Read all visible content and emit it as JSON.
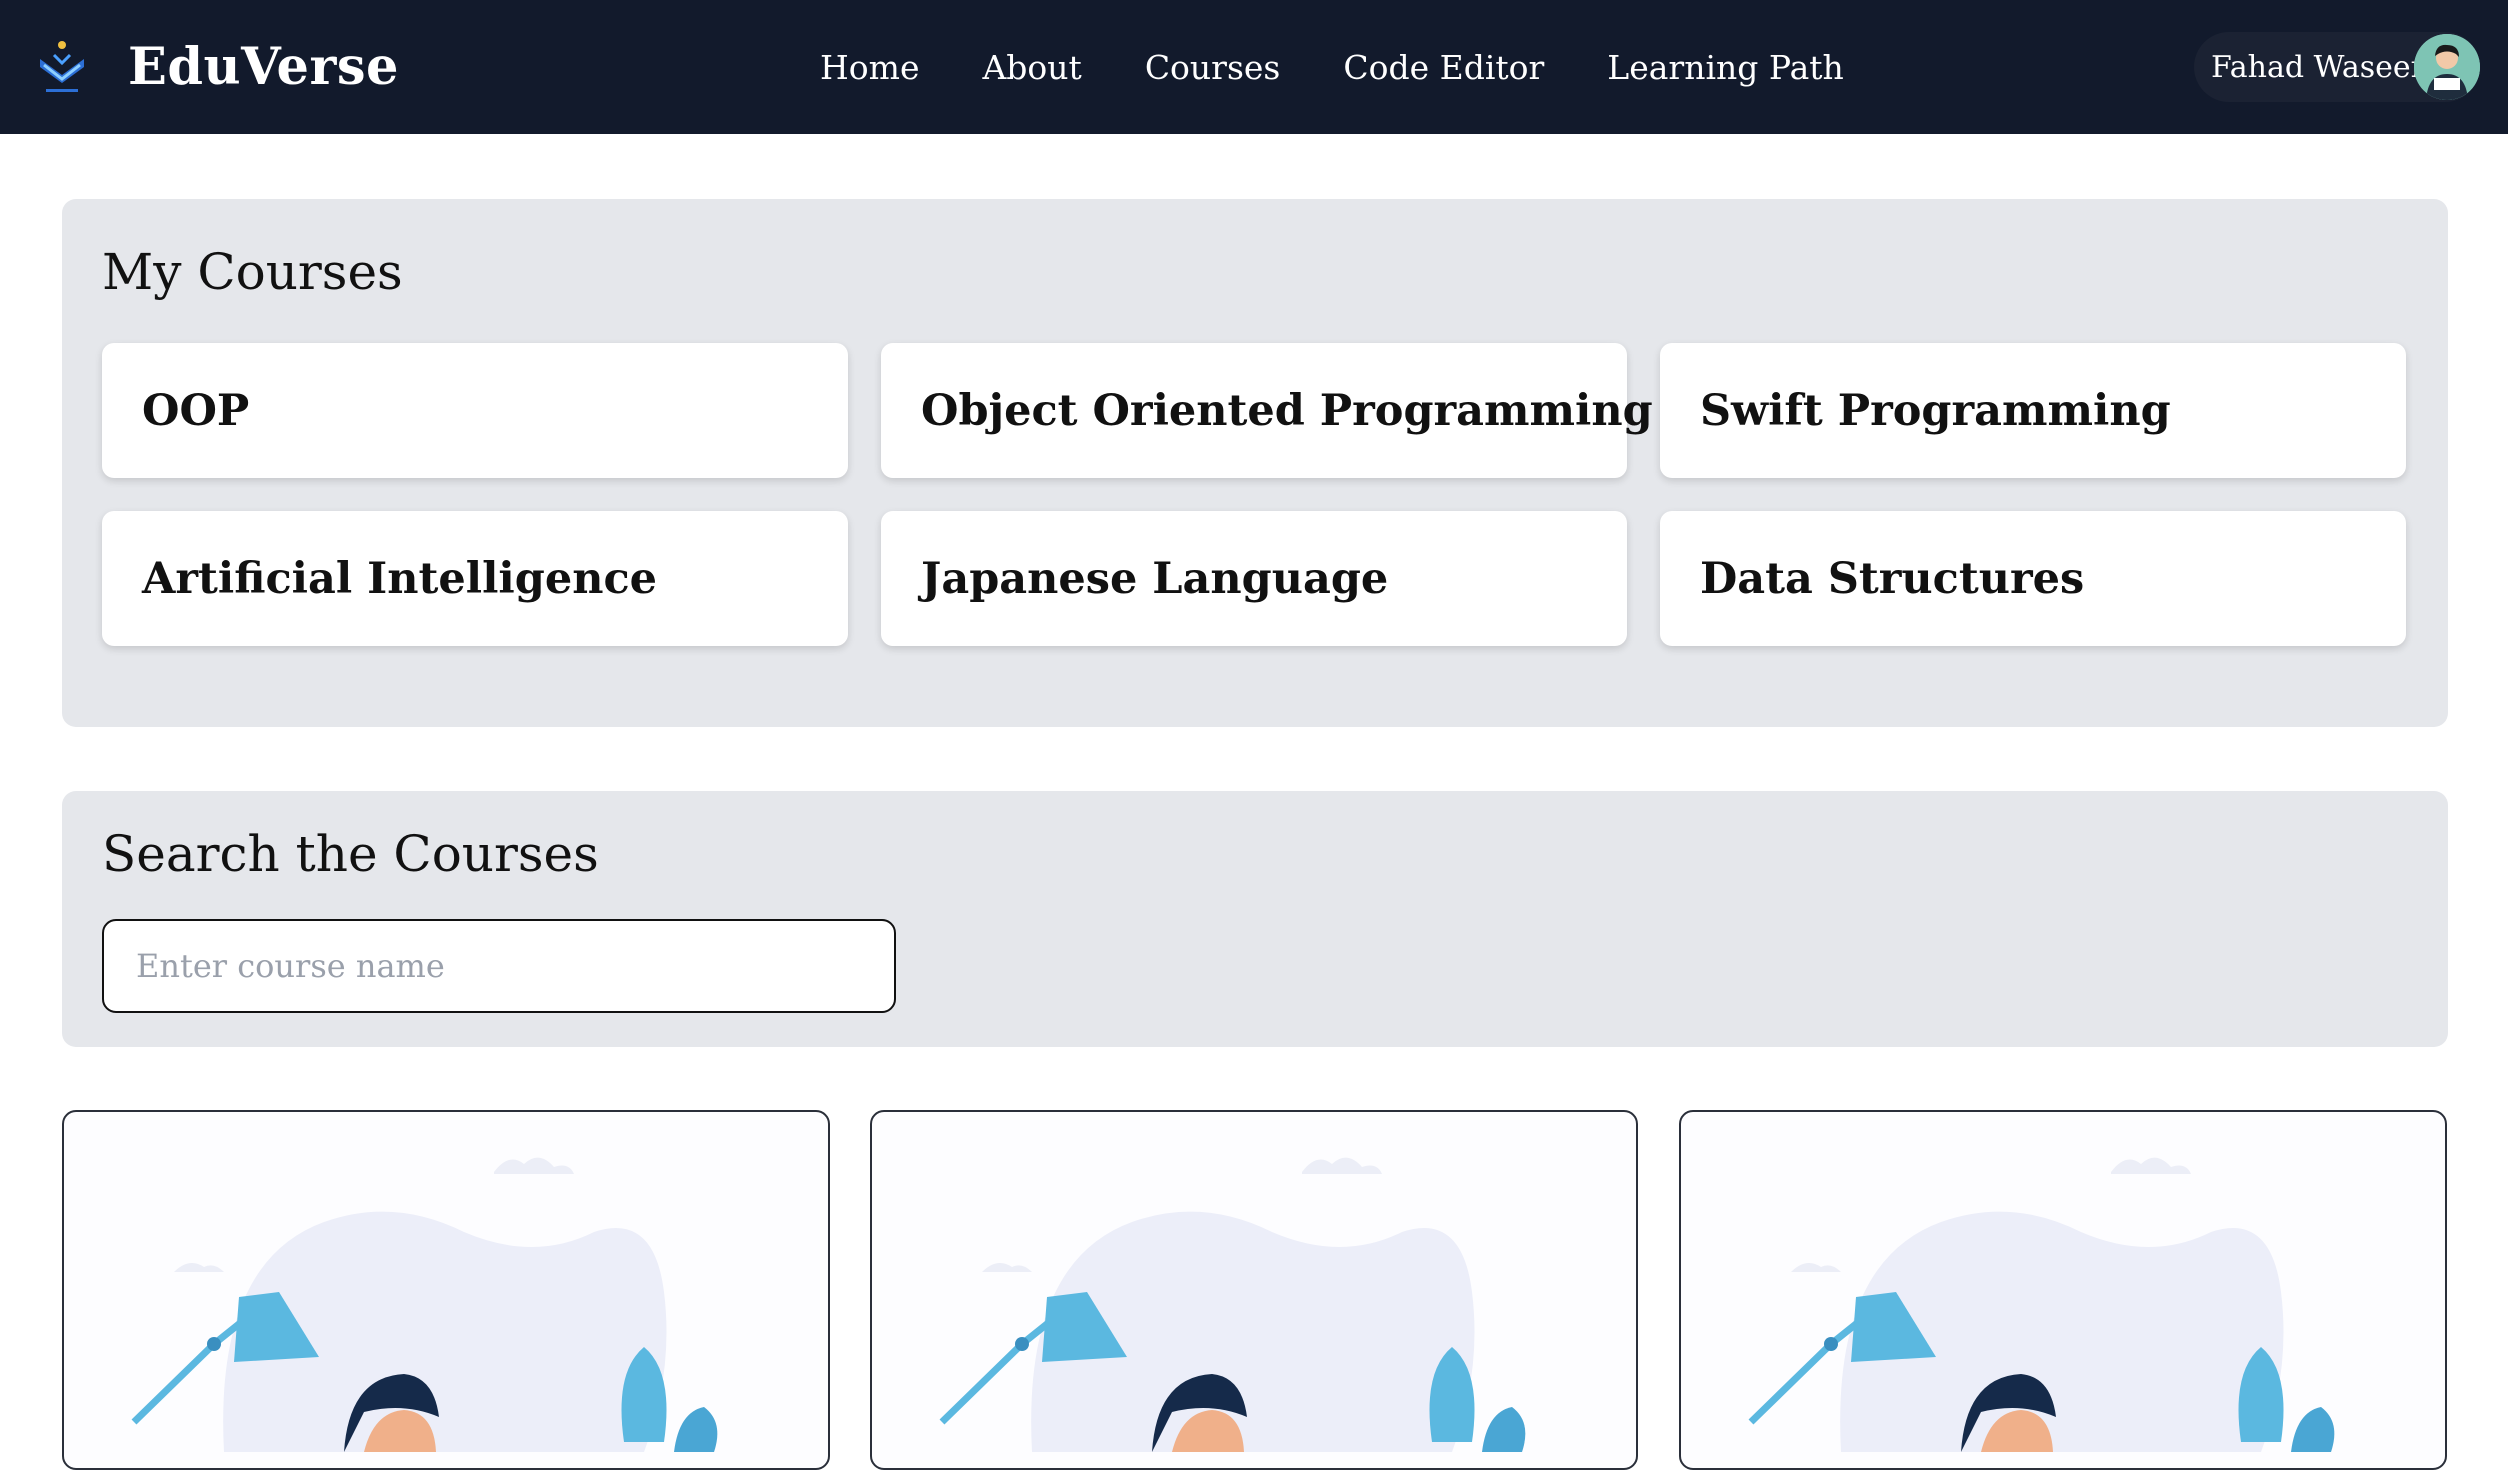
{
  "navbar": {
    "brand_name": "EduVerse",
    "logo_icon": "eduverse-logo-icon",
    "links": [
      {
        "label": "Home"
      },
      {
        "label": "About"
      },
      {
        "label": "Courses"
      },
      {
        "label": "Code Editor"
      },
      {
        "label": "Learning Path"
      }
    ],
    "user": {
      "name": "Fahad Waseem",
      "avatar_icon": "user-avatar-icon"
    },
    "background": "#121a2c"
  },
  "my_courses": {
    "title": "My Courses",
    "courses": [
      {
        "name": "OOP"
      },
      {
        "name": "Object Oriented Programming"
      },
      {
        "name": "Swift Programming"
      },
      {
        "name": "Artificial Intelligence"
      },
      {
        "name": "Japanese Language"
      },
      {
        "name": "Data Structures"
      }
    ]
  },
  "search": {
    "title": "Search the Courses",
    "placeholder": "Enter course name",
    "value": ""
  },
  "course_cards": [
    {
      "image_icon": "student-studying-illustration"
    },
    {
      "image_icon": "student-studying-illustration"
    },
    {
      "image_icon": "student-studying-illustration"
    }
  ],
  "colors": {
    "panel_bg": "#e5e7eb",
    "accent_blue": "#5bb8e0",
    "hair": "#152a4a"
  }
}
